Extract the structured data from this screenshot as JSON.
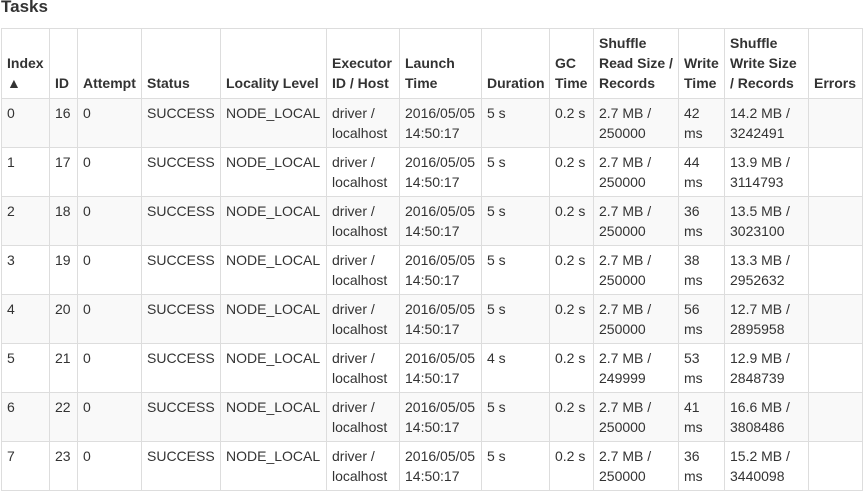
{
  "section_title": "Tasks",
  "sort": {
    "column": "Index",
    "direction": "ascending",
    "indicator": "▲"
  },
  "columns": [
    "Index",
    "ID",
    "Attempt",
    "Status",
    "Locality Level",
    "Executor ID / Host",
    "Launch Time",
    "Duration",
    "GC Time",
    "Shuffle Read Size / Records",
    "Write Time",
    "Shuffle Write Size / Records",
    "Errors"
  ],
  "rows": [
    [
      "0",
      "16",
      "0",
      "SUCCESS",
      "NODE_LOCAL",
      "driver / localhost",
      "2016/05/05 14:50:17",
      "5 s",
      "0.2 s",
      "2.7 MB / 250000",
      "42 ms",
      "14.2 MB / 3242491",
      ""
    ],
    [
      "1",
      "17",
      "0",
      "SUCCESS",
      "NODE_LOCAL",
      "driver / localhost",
      "2016/05/05 14:50:17",
      "5 s",
      "0.2 s",
      "2.7 MB / 250000",
      "44 ms",
      "13.9 MB / 3114793",
      ""
    ],
    [
      "2",
      "18",
      "0",
      "SUCCESS",
      "NODE_LOCAL",
      "driver / localhost",
      "2016/05/05 14:50:17",
      "5 s",
      "0.2 s",
      "2.7 MB / 250000",
      "36 ms",
      "13.5 MB / 3023100",
      ""
    ],
    [
      "3",
      "19",
      "0",
      "SUCCESS",
      "NODE_LOCAL",
      "driver / localhost",
      "2016/05/05 14:50:17",
      "5 s",
      "0.2 s",
      "2.7 MB / 250000",
      "38 ms",
      "13.3 MB / 2952632",
      ""
    ],
    [
      "4",
      "20",
      "0",
      "SUCCESS",
      "NODE_LOCAL",
      "driver / localhost",
      "2016/05/05 14:50:17",
      "5 s",
      "0.2 s",
      "2.7 MB / 250000",
      "56 ms",
      "12.7 MB / 2895958",
      ""
    ],
    [
      "5",
      "21",
      "0",
      "SUCCESS",
      "NODE_LOCAL",
      "driver / localhost",
      "2016/05/05 14:50:17",
      "4 s",
      "0.2 s",
      "2.7 MB / 249999",
      "53 ms",
      "12.9 MB / 2848739",
      ""
    ],
    [
      "6",
      "22",
      "0",
      "SUCCESS",
      "NODE_LOCAL",
      "driver / localhost",
      "2016/05/05 14:50:17",
      "5 s",
      "0.2 s",
      "2.7 MB / 250000",
      "41 ms",
      "16.6 MB / 3808486",
      ""
    ],
    [
      "7",
      "23",
      "0",
      "SUCCESS",
      "NODE_LOCAL",
      "driver / localhost",
      "2016/05/05 14:50:17",
      "5 s",
      "0.2 s",
      "2.7 MB / 250000",
      "36 ms",
      "15.2 MB / 3440098",
      ""
    ]
  ]
}
